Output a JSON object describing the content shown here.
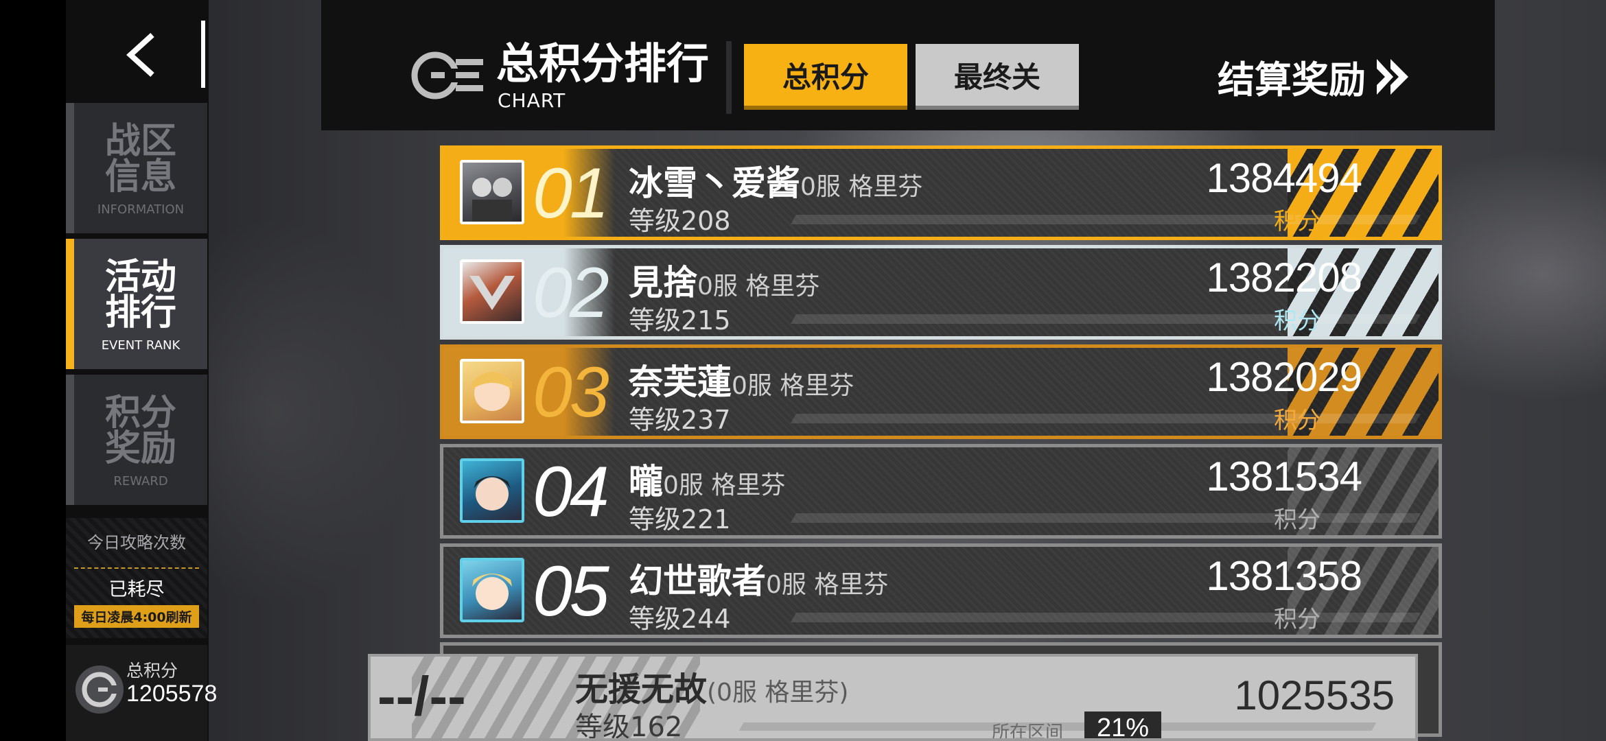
{
  "header": {
    "title": "总积分排行",
    "subtitle": "CHART",
    "tabs": [
      {
        "label": "总积分",
        "active": true
      },
      {
        "label": "最终关",
        "active": false
      }
    ],
    "settle_label": "结算奖励"
  },
  "sidebar": {
    "items": [
      {
        "label_cn": "战区\n信息",
        "label_en": "INFORMATION",
        "active": false
      },
      {
        "label_cn": "活动\n排行",
        "label_en": "EVENT RANK",
        "active": true
      },
      {
        "label_cn": "积分\n奖励",
        "label_en": "REWARD",
        "active": false
      }
    ],
    "daily": {
      "title": "今日攻略次数",
      "status": "已耗尽",
      "refresh": "每日凌晨4:00刷新"
    },
    "total": {
      "label": "总积分",
      "value": "1205578"
    }
  },
  "ranking": [
    {
      "rank": "01",
      "name": "冰雪丶爱酱",
      "server": "0服  格里芬",
      "level": "等级208",
      "score": "1384494",
      "score_label": "积分",
      "tier": "gold"
    },
    {
      "rank": "02",
      "name": "見捨",
      "server": "0服  格里芬",
      "level": "等级215",
      "score": "1382208",
      "score_label": "积分",
      "tier": "silver"
    },
    {
      "rank": "03",
      "name": "奈芙蓮",
      "server": "0服  格里芬",
      "level": "等级237",
      "score": "1382029",
      "score_label": "积分",
      "tier": "bronze"
    },
    {
      "rank": "04",
      "name": "曨",
      "server": "0服  格里芬",
      "level": "等级221",
      "score": "1381534",
      "score_label": "积分",
      "tier": "normal"
    },
    {
      "rank": "05",
      "name": "幻世歌者",
      "server": "0服  格里芬",
      "level": "等级244",
      "score": "1381358",
      "score_label": "积分",
      "tier": "normal"
    }
  ],
  "self": {
    "rank": "--/--",
    "name": "无援无故",
    "server": "(0服  格里芬)",
    "level": "等级162",
    "score": "1025535",
    "interval_label": "所在区间",
    "interval_value": "21%"
  },
  "colors": {
    "accent_gold": "#f6ae16",
    "silver": "#d4dde0",
    "bronze": "#d28a1d",
    "cyan_label": "#aee8f2"
  }
}
